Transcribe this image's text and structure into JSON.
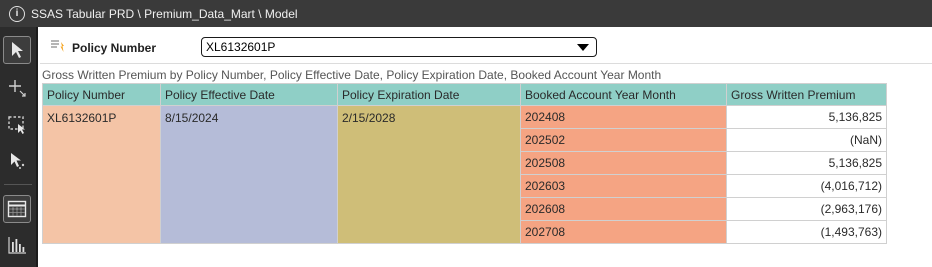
{
  "title": "SSAS Tabular PRD \\ Premium_Data_Mart \\ Model",
  "filter": {
    "label": "Policy Number",
    "value": "XL6132601P"
  },
  "grid": {
    "title": "Gross Written Premium by Policy Number, Policy Effective Date, Policy Expiration Date, Booked Account Year Month",
    "headers": [
      "Policy Number",
      "Policy Effective Date",
      "Policy Expiration Date",
      "Booked Account Year Month",
      "Gross Written Premium"
    ],
    "policy_number": "XL6132601P",
    "effective_date": "8/15/2024",
    "expiration_date": "2/15/2028",
    "rows": [
      {
        "month": "202408",
        "premium": "5,136,825"
      },
      {
        "month": "202502",
        "premium": "(NaN)"
      },
      {
        "month": "202508",
        "premium": "5,136,825"
      },
      {
        "month": "202603",
        "premium": "(4,016,712)"
      },
      {
        "month": "202608",
        "premium": "(2,963,176)"
      },
      {
        "month": "202708",
        "premium": "(1,493,763)"
      }
    ]
  },
  "toolbar": {
    "icons": [
      "pointer-icon",
      "crosshair-icon",
      "marquee-select-icon",
      "cursor-sparkle-icon",
      "table-grid-icon",
      "bar-chart-icon"
    ]
  }
}
